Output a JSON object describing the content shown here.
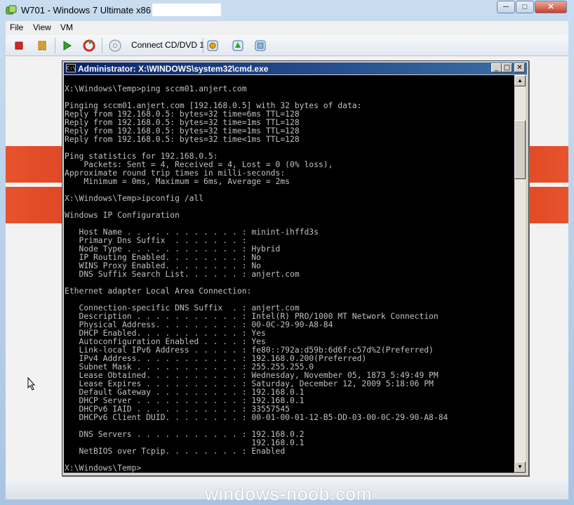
{
  "window": {
    "title": "W701 - Windows 7 Ultimate x86 on",
    "controls": {
      "minimize": "─",
      "maximize": "□",
      "close": "✕"
    }
  },
  "menu": {
    "items": [
      {
        "label": "File"
      },
      {
        "label": "View"
      },
      {
        "label": "VM"
      }
    ]
  },
  "toolbar": {
    "buttons": [
      {
        "icon": "stop-icon"
      },
      {
        "icon": "pause-icon"
      },
      {
        "icon": "play-icon"
      },
      {
        "icon": "reset-icon"
      },
      {
        "icon": "cd-dvd-icon",
        "label": "Connect CD/DVD 1"
      },
      {
        "icon": "snapshot-icon"
      },
      {
        "icon": "revert-snapshot-icon"
      },
      {
        "icon": "manage-snapshots-icon"
      }
    ],
    "cd_label": "Connect CD/DVD 1"
  },
  "console_window": {
    "title": "Administrator: X:\\WINDOWS\\system32\\cmd.exe",
    "icon_text": "C:\\",
    "controls": {
      "minimize": "_",
      "maximize": "□",
      "close": "✕"
    },
    "lines": [
      "X:\\Windows\\Temp>ping sccm01.anjert.com",
      "",
      "Pinging sccm01.anjert.com [192.168.0.5] with 32 bytes of data:",
      "Reply from 192.168.0.5: bytes=32 time=6ms TTL=128",
      "Reply from 192.168.0.5: bytes=32 time=1ms TTL=128",
      "Reply from 192.168.0.5: bytes=32 time=1ms TTL=128",
      "Reply from 192.168.0.5: bytes=32 time<1ms TTL=128",
      "",
      "Ping statistics for 192.168.0.5:",
      "    Packets: Sent = 4, Received = 4, Lost = 0 (0% loss),",
      "Approximate round trip times in milli-seconds:",
      "    Minimum = 0ms, Maximum = 6ms, Average = 2ms",
      "",
      "X:\\Windows\\Temp>ipconfig /all",
      "",
      "Windows IP Configuration",
      "",
      "   Host Name . . . . . . . . . . . . : minint-ihffd3s",
      "   Primary Dns Suffix  . . . . . . . :",
      "   Node Type . . . . . . . . . . . . : Hybrid",
      "   IP Routing Enabled. . . . . . . . : No",
      "   WINS Proxy Enabled. . . . . . . . : No",
      "   DNS Suffix Search List. . . . . . : anjert.com",
      "",
      "Ethernet adapter Local Area Connection:",
      "",
      "   Connection-specific DNS Suffix  . : anjert.com",
      "   Description . . . . . . . . . . . : Intel(R) PRO/1000 MT Network Connection",
      "   Physical Address. . . . . . . . . : 00-0C-29-90-A8-84",
      "   DHCP Enabled. . . . . . . . . . . : Yes",
      "   Autoconfiguration Enabled . . . . : Yes",
      "   Link-local IPv6 Address . . . . . : fe80::792a:d59b:6d6f:c57d%2(Preferred)",
      "   IPv4 Address. . . . . . . . . . . : 192.168.0.200(Preferred)",
      "   Subnet Mask . . . . . . . . . . . : 255.255.255.0",
      "   Lease Obtained. . . . . . . . . . : Wednesday, November 05, 1873 5:49:49 PM",
      "   Lease Expires . . . . . . . . . . : Saturday, December 12, 2009 5:18:06 PM",
      "   Default Gateway . . . . . . . . . : 192.168.0.1",
      "   DHCP Server . . . . . . . . . . . : 192.168.0.1",
      "   DHCPv6 IAID . . . . . . . . . . . : 33557545",
      "   DHCPv6 Client DUID. . . . . . . . : 00-01-00-01-12-B5-DD-03-00-0C-29-90-A8-84",
      "",
      "   DNS Servers . . . . . . . . . . . : 192.168.0.2",
      "                                       192.168.0.1",
      "   NetBIOS over Tcpip. . . . . . . . : Enabled",
      "",
      "X:\\Windows\\Temp>"
    ],
    "scroll_up": "▲",
    "scroll_down": "▼"
  },
  "watermark": "windows-noob.com",
  "colors": {
    "console_bg": "#000000",
    "console_text": "#c0c0c0",
    "title_active": "#0a246a",
    "guest_band": "#cc2a12"
  }
}
